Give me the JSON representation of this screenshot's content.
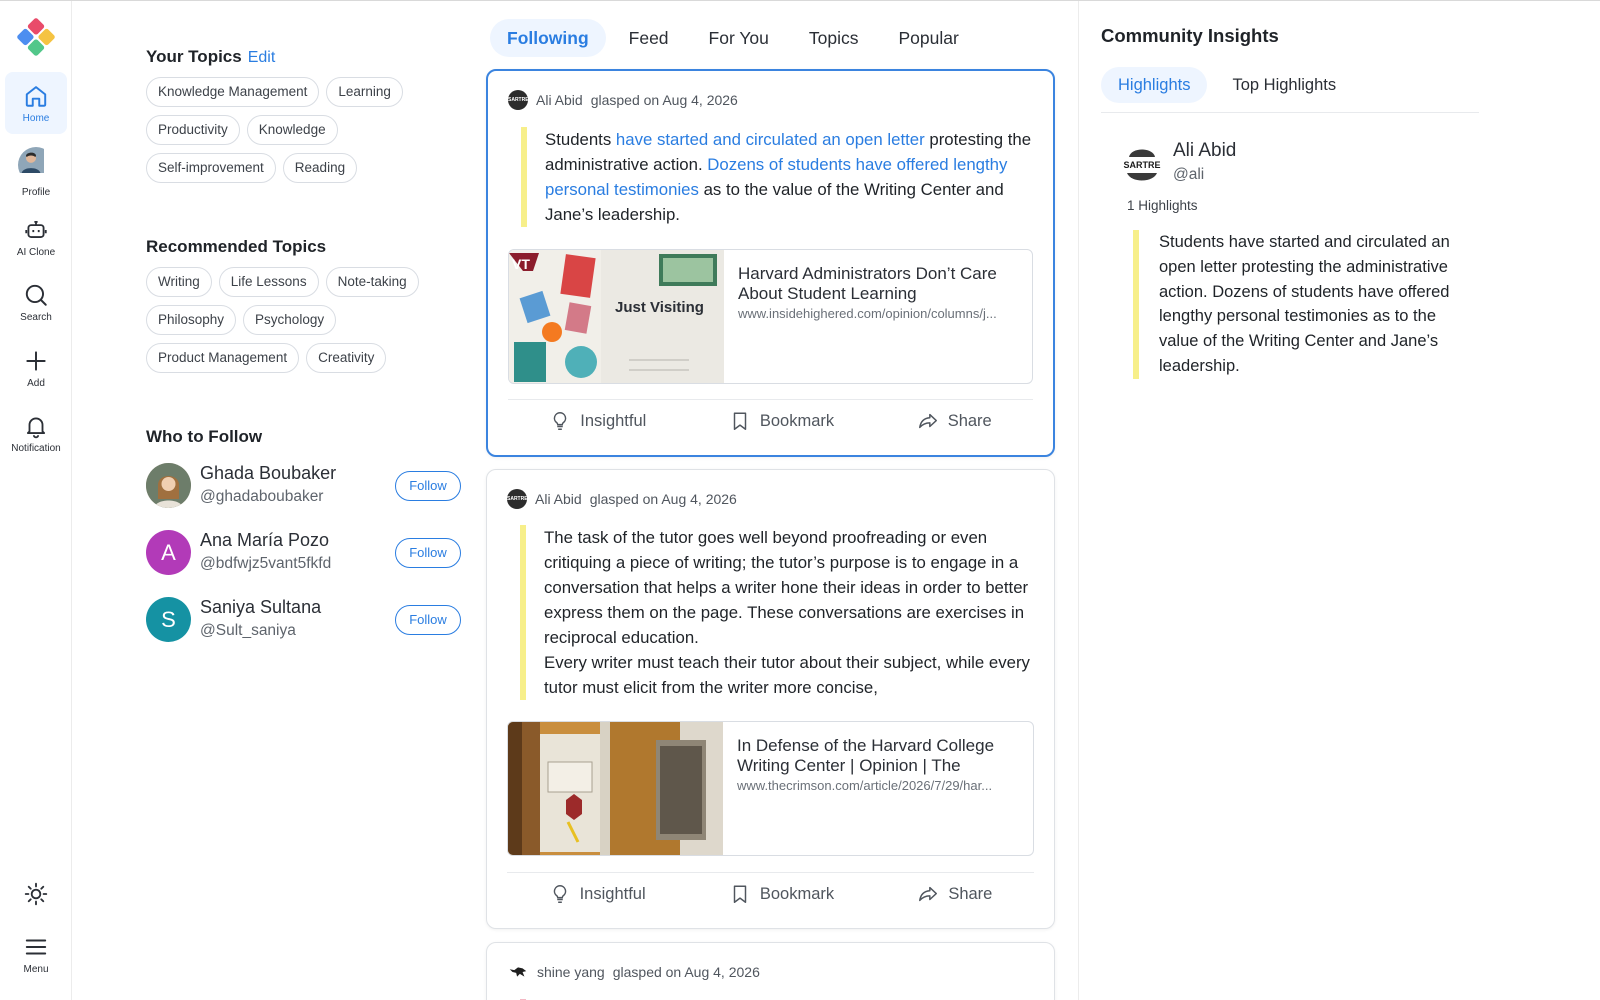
{
  "colors": {
    "accent": "#2a7de1",
    "highlight_bar": "#f7ef8a",
    "active_bg": "#eef5ff"
  },
  "rail": {
    "items": [
      {
        "label": "Home",
        "icon": "home-icon"
      },
      {
        "label": "Profile",
        "icon": "avatar"
      },
      {
        "label": "AI Clone",
        "icon": "robot-icon"
      },
      {
        "label": "Search",
        "icon": "search-icon"
      },
      {
        "label": "Add",
        "icon": "plus-icon"
      },
      {
        "label": "Notification",
        "icon": "bell-icon"
      }
    ],
    "theme_icon": "sun-icon",
    "menu": {
      "label": "Menu",
      "icon": "hamburger-icon"
    }
  },
  "your_topics": {
    "title": "Your Topics",
    "edit_label": "Edit",
    "chips": [
      "Knowledge Management",
      "Learning",
      "Productivity",
      "Knowledge",
      "Self-improvement",
      "Reading"
    ]
  },
  "recommended": {
    "title": "Recommended Topics",
    "chips": [
      "Writing",
      "Life Lessons",
      "Note-taking",
      "Philosophy",
      "Psychology",
      "Product Management",
      "Creativity"
    ]
  },
  "who_to_follow": {
    "title": "Who to Follow",
    "follow_label": "Follow",
    "people": [
      {
        "name": "Ghada Boubaker",
        "handle": "@ghadaboubaker",
        "initial": ""
      },
      {
        "name": "Ana María Pozo",
        "handle": "@bdfwjz5vant5fkfd",
        "initial": "A"
      },
      {
        "name": "Saniya Sultana",
        "handle": "@Sult_saniya",
        "initial": "S"
      }
    ]
  },
  "feed": {
    "tabs": [
      "Following",
      "Feed",
      "For You",
      "Topics",
      "Popular"
    ],
    "active_tab": "Following",
    "actions": {
      "insightful": "Insightful",
      "bookmark": "Bookmark",
      "share": "Share"
    },
    "posts": [
      {
        "author": "Ali Abid",
        "meta": "glasped on Aug 4, 2026",
        "avatar_text": "SARTRE",
        "quote": {
          "p1": "Students ",
          "h1": "have started and circulated an open letter",
          "p2": " protesting the administrative action. ",
          "h2": "Dozens of students have offered lengthy personal testimonies",
          "p3": " as to the value of the Writing Center and Jane’s leadership."
        },
        "link": {
          "title": "Harvard Administrators Don’t Care About Student Learning",
          "url": "www.insidehighered.com/opinion/columns/j...",
          "thumb_text": "Just Visiting",
          "sticker_vt": "VT"
        }
      },
      {
        "author": "Ali Abid",
        "meta": "glasped on Aug 4, 2026",
        "avatar_text": "SARTRE",
        "quote": {
          "line1": "The task of the tutor goes well beyond proofreading or even critiquing a piece of writing; the tutor’s purpose is to engage in a conversation that helps a writer hone their ideas in order to better express them on the page. These conversations are exercises in reciprocal education.",
          "line2": "Every writer must teach their tutor about their subject, while every tutor must elicit from the writer more concise,"
        },
        "link": {
          "title": "In Defense of the Harvard College Writing Center | Opinion | The",
          "url": "www.thecrimson.com/article/2026/7/29/har..."
        }
      },
      {
        "author": "shine yang",
        "meta": "glasped on Aug 4, 2026"
      }
    ]
  },
  "insights": {
    "title": "Community Insights",
    "tabs": [
      "Highlights",
      "Top Highlights"
    ],
    "user": {
      "name": "Ali Abid",
      "handle": "@ali",
      "avatar_text": "SARTRE"
    },
    "count": "1 Highlights",
    "quote": "Students have started and circulated an open letter protesting the administrative action. Dozens of students have offered lengthy personal testimonies as to the value of the Writing Center and Jane’s leadership."
  }
}
